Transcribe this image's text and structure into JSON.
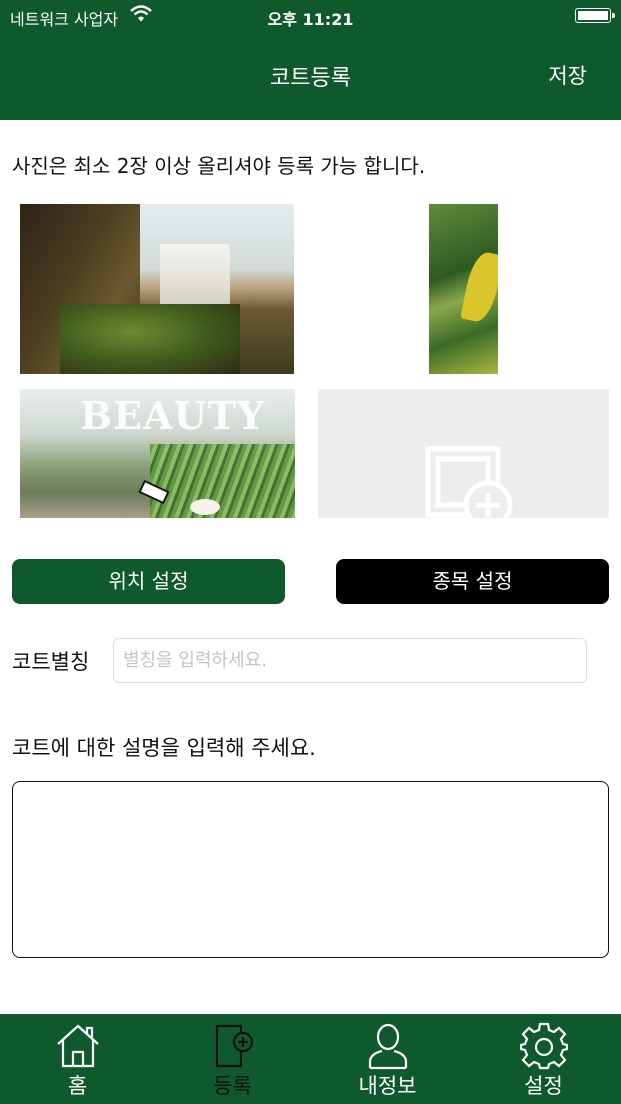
{
  "status_bar": {
    "carrier": "네트워크 사업자",
    "time": "오후 11:21"
  },
  "nav": {
    "title": "코트등록",
    "save_label": "저장"
  },
  "notice": "사진은 최소 2장 이상 올리셔야 등록 가능 합니다.",
  "photos": {
    "photo3_text": "BEAUTY"
  },
  "buttons": {
    "location_label": "위치 설정",
    "sport_label": "종목 설정"
  },
  "alias": {
    "label": "코트별칭",
    "placeholder": "별칭을 입력하세요.",
    "value": ""
  },
  "description": {
    "label": "코트에 대한 설명을 입력해 주세요.",
    "value": ""
  },
  "tabs": [
    {
      "label": "홈",
      "icon": "home-icon"
    },
    {
      "label": "등록",
      "icon": "register-icon"
    },
    {
      "label": "내정보",
      "icon": "profile-icon"
    },
    {
      "label": "설정",
      "icon": "gear-icon"
    }
  ],
  "colors": {
    "brand_green": "#0f5a2c",
    "black_button": "#000000",
    "add_photo_bg": "#ededed"
  }
}
